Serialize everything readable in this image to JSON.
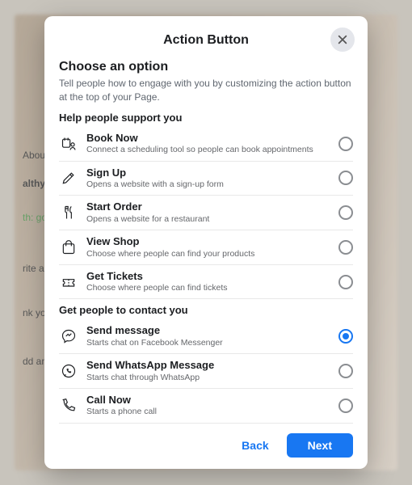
{
  "dialog": {
    "title": "Action Button",
    "close_aria": "Close",
    "heading": "Choose an option",
    "subheading": "Tell people how to engage with you by customizing the action button at the top of your Page.",
    "section1_label": "Help people support you",
    "section2_label": "Get people to contact you",
    "selected_id": "send-message",
    "back_label": "Back",
    "next_label": "Next"
  },
  "options_section1": [
    {
      "id": "book-now",
      "icon": "calendar-person-icon",
      "title": "Book Now",
      "desc": "Connect a scheduling tool so people can book appointments"
    },
    {
      "id": "sign-up",
      "icon": "pencil-icon",
      "title": "Sign Up",
      "desc": "Opens a website with a sign-up form"
    },
    {
      "id": "start-order",
      "icon": "utensils-icon",
      "title": "Start Order",
      "desc": "Opens a website for a restaurant"
    },
    {
      "id": "view-shop",
      "icon": "shopping-bag-icon",
      "title": "View Shop",
      "desc": "Choose where people can find your products"
    },
    {
      "id": "get-tickets",
      "icon": "ticket-icon",
      "title": "Get Tickets",
      "desc": "Choose where people can find tickets"
    }
  ],
  "options_section2": [
    {
      "id": "send-message",
      "icon": "messenger-icon",
      "title": "Send message",
      "desc": "Starts chat on Facebook Messenger"
    },
    {
      "id": "send-whatsapp",
      "icon": "whatsapp-icon",
      "title": "Send WhatsApp Message",
      "desc": "Starts chat through WhatsApp"
    },
    {
      "id": "call-now",
      "icon": "phone-icon",
      "title": "Call Now",
      "desc": "Starts a phone call"
    }
  ],
  "backdrop_text": {
    "t1": "About",
    "t2": "althy",
    "t3": "th: goo",
    "t4": "rite a",
    "t5": "nk you",
    "t6": "dd an"
  },
  "colors": {
    "primary": "#1877f2"
  }
}
